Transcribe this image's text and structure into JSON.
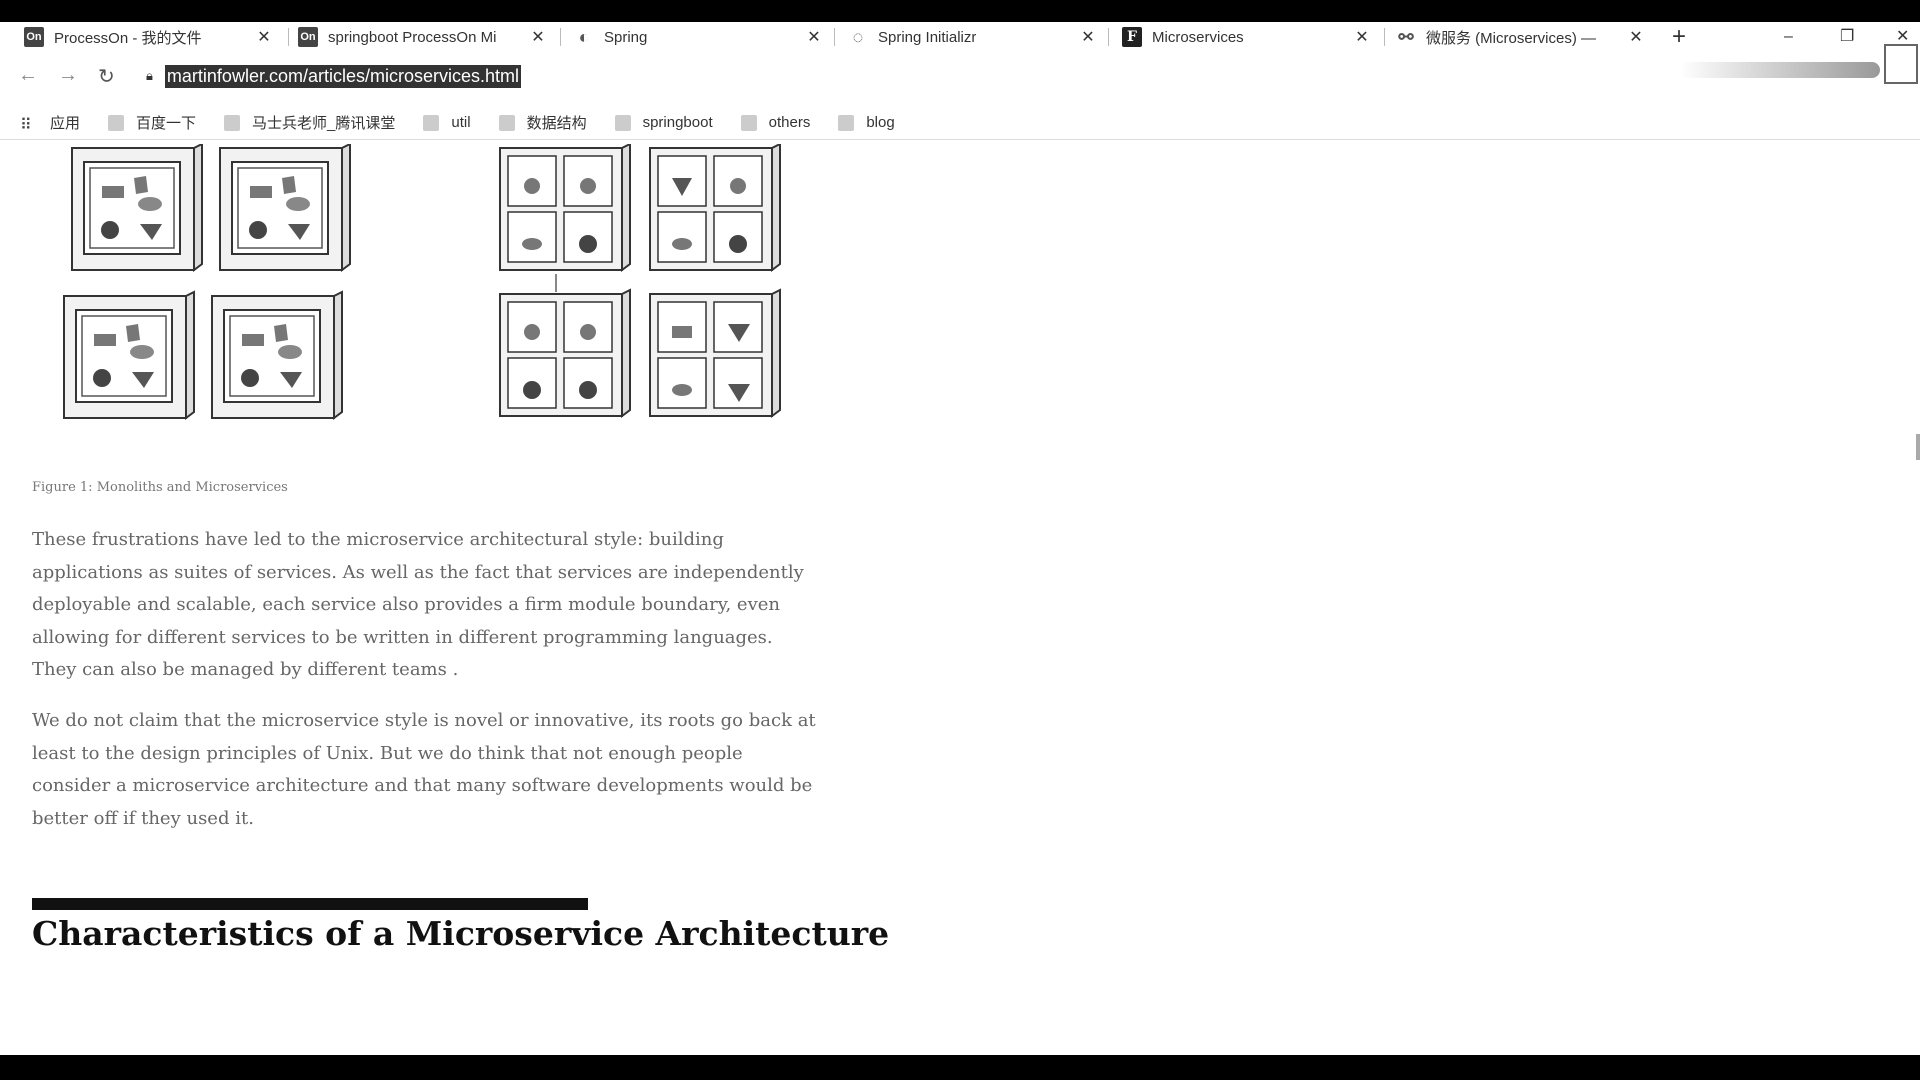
{
  "tabs": [
    {
      "icon": "On",
      "title": "ProcessOn - 我的文件"
    },
    {
      "icon": "On",
      "title": "springboot ProcessOn Mi"
    },
    {
      "icon": "spring-icon",
      "title": "Spring"
    },
    {
      "icon": "spring-initializr-icon",
      "title": "Spring Initializr"
    },
    {
      "icon": "F",
      "title": "Microservices"
    },
    {
      "icon": "link-icon",
      "title": "微服务 (Microservices) —"
    }
  ],
  "address": {
    "url": "martinfowler.com/articles/microservices.html"
  },
  "bookmarks": [
    {
      "label": "应用",
      "icon": "apps-grid-icon"
    },
    {
      "label": "百度一下",
      "icon": "baidu-icon"
    },
    {
      "label": "马士兵老师_腾讯课堂",
      "icon": "tencent-icon"
    },
    {
      "label": "util",
      "icon": "folder-icon"
    },
    {
      "label": "数据结构",
      "icon": "folder-icon"
    },
    {
      "label": "springboot",
      "icon": "folder-icon"
    },
    {
      "label": "others",
      "icon": "folder-icon"
    },
    {
      "label": "blog",
      "icon": "folder-icon"
    }
  ],
  "article": {
    "caption": "Figure 1: Monoliths and Microservices",
    "paragraph1": "These frustrations have led to the microservice architectural style: building applications as suites of services. As well as the fact that services are independently deployable and scalable, each service also provides a firm module boundary, even allowing for different services to be written in different programming languages. They can also be managed by different teams .",
    "paragraph2": "We do not claim that the microservice style is novel or innovative, its roots go back at least to the design principles of Unix. But we do think that not enough people consider a microservice architecture and that many software developments would be better off if they used it.",
    "heading": "Characteristics of a Microservice Architecture"
  }
}
